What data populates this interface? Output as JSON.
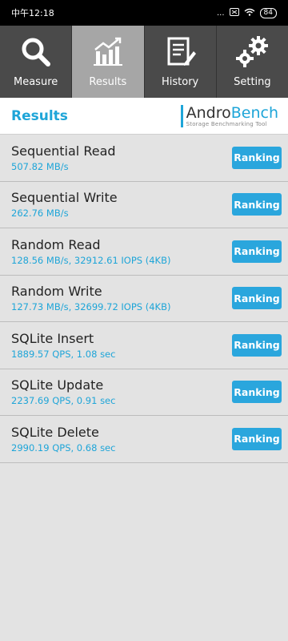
{
  "status": {
    "time": "中午12:18",
    "dots": "...",
    "battery": "84"
  },
  "tabs": [
    {
      "label": "Measure",
      "icon": "search-icon"
    },
    {
      "label": "Results",
      "icon": "chart-icon"
    },
    {
      "label": "History",
      "icon": "document-icon"
    },
    {
      "label": "Setting",
      "icon": "gear-icon"
    }
  ],
  "header": {
    "title": "Results",
    "logo_andro": "Andro",
    "logo_bench": "Bench",
    "logo_subtitle": "Storage Benchmarking Tool"
  },
  "results": [
    {
      "name": "Sequential Read",
      "value": "507.82 MB/s",
      "button": "Ranking"
    },
    {
      "name": "Sequential Write",
      "value": "262.76 MB/s",
      "button": "Ranking"
    },
    {
      "name": "Random Read",
      "value": "128.56 MB/s, 32912.61 IOPS (4KB)",
      "button": "Ranking"
    },
    {
      "name": "Random Write",
      "value": "127.73 MB/s, 32699.72 IOPS (4KB)",
      "button": "Ranking"
    },
    {
      "name": "SQLite Insert",
      "value": "1889.57 QPS, 1.08 sec",
      "button": "Ranking"
    },
    {
      "name": "SQLite Update",
      "value": "2237.69 QPS, 0.91 sec",
      "button": "Ranking"
    },
    {
      "name": "SQLite Delete",
      "value": "2990.19 QPS, 0.68 sec",
      "button": "Ranking"
    }
  ],
  "colors": {
    "accent": "#1ea5d8",
    "tab_bg": "#4a4a4a",
    "tab_active": "#a6a6a6"
  }
}
